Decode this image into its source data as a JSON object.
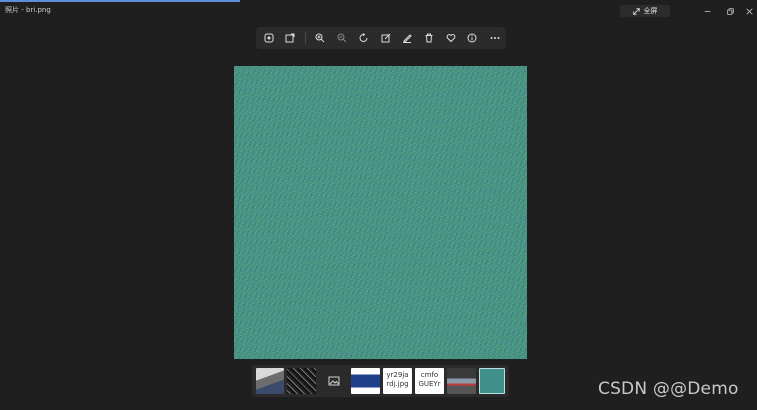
{
  "window": {
    "title": "照片 - bri.png",
    "fullscreen_label": "全屏",
    "controls": [
      "minimize",
      "restore",
      "close"
    ]
  },
  "toolbar": {
    "buttons": [
      {
        "name": "enhance-button",
        "icon": "enhance-icon"
      },
      {
        "name": "edit-image-button",
        "icon": "edit-image-icon"
      },
      {
        "name": "zoom-in-button",
        "icon": "zoom-in-icon"
      },
      {
        "name": "zoom-out-button",
        "icon": "zoom-out-icon"
      },
      {
        "name": "rotate-button",
        "icon": "rotate-icon"
      },
      {
        "name": "edit-button",
        "icon": "edit-icon"
      },
      {
        "name": "draw-button",
        "icon": "pen-icon"
      },
      {
        "name": "delete-button",
        "icon": "trash-icon"
      },
      {
        "name": "favorite-button",
        "icon": "heart-icon"
      },
      {
        "name": "info-button",
        "icon": "info-icon"
      },
      {
        "name": "more-button",
        "icon": "more-icon"
      }
    ]
  },
  "image": {
    "description_icon": "noise-image",
    "colors": [
      "#3f8f73",
      "#5a6eb4",
      "#3cc86e"
    ]
  },
  "filmstrip": {
    "thumbnails": [
      {
        "kind": "photo"
      },
      {
        "kind": "photo"
      },
      {
        "kind": "placeholder",
        "icon": "image-placeholder-icon"
      },
      {
        "kind": "photo"
      },
      {
        "kind": "text",
        "lines": [
          "yr29ja",
          "rdj.jpg"
        ]
      },
      {
        "kind": "text",
        "lines": [
          "cmfo",
          "GUEYr"
        ]
      },
      {
        "kind": "photo"
      },
      {
        "kind": "selected"
      }
    ]
  },
  "watermark": {
    "text": "CSDN @@Demo"
  }
}
